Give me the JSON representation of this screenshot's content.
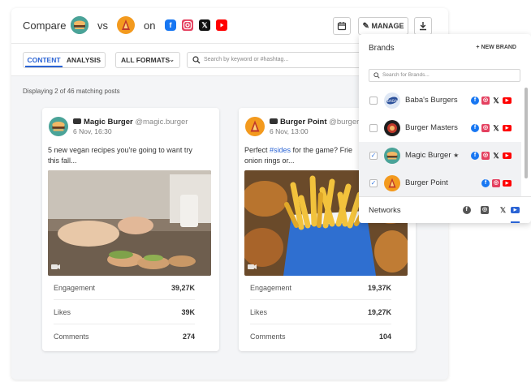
{
  "header": {
    "compare_label": "Compare",
    "vs_label": "vs",
    "on_label": "on",
    "manage_label": "MANAGE",
    "colors": {
      "facebook": "#1877f2",
      "instagram": "#e4405f",
      "x": "#111111",
      "youtube": "#ff0000"
    }
  },
  "toolbar": {
    "tab_content": "CONTENT",
    "tab_analysis": "ANALYSIS",
    "formats_label": "ALL FORMATS",
    "search_placeholder": "Search by keyword or #hashtag..."
  },
  "count_text": "Displaying 2 of 46 matching posts",
  "posts": [
    {
      "brand": "Magic Burger",
      "handle": "@magic.burger",
      "date": "6 Nov, 16:30",
      "text_line1": "5 new vegan recipes you're going to want try",
      "text_line2": "this fall...",
      "stats": [
        {
          "label": "Engagement",
          "value": "39,27K"
        },
        {
          "label": "Likes",
          "value": "39K"
        },
        {
          "label": "Comments",
          "value": "274"
        }
      ]
    },
    {
      "brand": "Burger Point",
      "handle": "@burger_",
      "date": "6 Nov, 13:00",
      "text_pre": "Perfect ",
      "hashtag": "#sides",
      "text_post": " for the game? Frie",
      "text_line2": "onion rings or...",
      "stats": [
        {
          "label": "Engagement",
          "value": "19,37K"
        },
        {
          "label": "Likes",
          "value": "19,27K"
        },
        {
          "label": "Comments",
          "value": "104"
        }
      ]
    }
  ],
  "brands_panel": {
    "title": "Brands",
    "new_brand_label": "+ NEW BRAND",
    "search_placeholder": "Search for Brands...",
    "brands": [
      {
        "name": "Baba's Burgers",
        "checked": false
      },
      {
        "name": "Burger Masters",
        "checked": false
      },
      {
        "name": "Magic Burger",
        "checked": true,
        "star": "★"
      },
      {
        "name": "Burger Point",
        "checked": true
      }
    ],
    "networks_label": "Networks"
  }
}
